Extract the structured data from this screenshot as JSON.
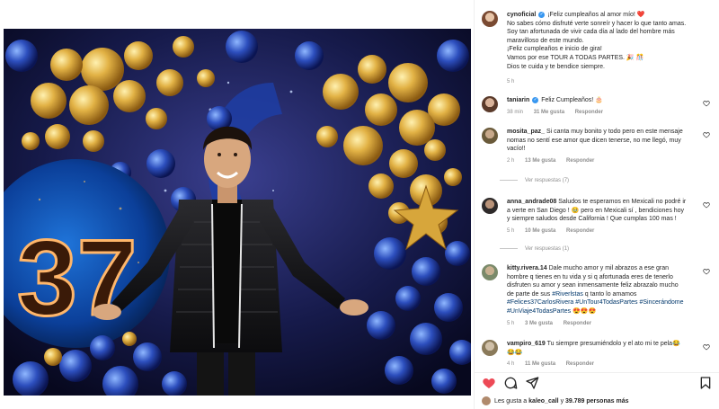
{
  "post": {
    "photo_caption_number": "37",
    "author": {
      "username": "cynoficial",
      "caption_line1": "¡Feliz cumpleaños al amor mío! ❤️",
      "caption_line2": "No sabes cómo disfruté verte sonreír y hacer lo que tanto amas.",
      "caption_line3": "Soy tan afortunada de vivir cada día al lado del hombre más",
      "caption_line4": "maravilloso de este mundo.",
      "caption_line5": "¡Feliz cumpleaños e inicio de gira!",
      "caption_line6": "Vamos por ese TOUR A TODAS PARTES. 🎉 🎊",
      "caption_line7": "Dios te cuida y te bendice siempre.",
      "time": "5 h"
    }
  },
  "comments": [
    {
      "username": "taniarin",
      "verified": true,
      "text": "Feliz Cumpleaños! 🎂",
      "time": "38 min",
      "likes": "31 Me gusta",
      "reply": "Responder"
    },
    {
      "username": "mosita_paz_",
      "text_line1": "Si canta muy bonito y todo pero en este mensaje",
      "text_line2": "nomas no sentí ese amor que dicen tenerse, no me llegó, muy",
      "text_line3": "vacío!!",
      "time": "2 h",
      "likes": "13 Me gusta",
      "reply": "Responder",
      "view_replies": "Ver respuestas (7)"
    },
    {
      "username": "anna_andrade08",
      "text_line1": "Saludos te esperamos en Mexicali no podré ir",
      "text_line2": "a verte en San Diego ! 🥹 pero en Mexicali sí , bendiciones hoy",
      "text_line3": "y siempre saludos desde California ! Que cumplas 100 mas !",
      "time": "5 h",
      "likes": "10 Me gusta",
      "reply": "Responder",
      "view_replies": "Ver respuestas (1)"
    },
    {
      "username": "kitty.rivera.14",
      "text_line1": "Dale mucho amor y mil abrazos a ese gran",
      "text_line2": "hombre q tienes en tu vida y si q afortunada eres de tenerlo",
      "text_line3": "disfruten su amor y sean inmensamente feliz abrazalo mucho",
      "text_line4": "de parte de sus",
      "text_line4_tag": "#Riverlstas",
      "text_line4_end": "q tanto lo amamos",
      "hashtags_line5": "#Felices37CarlosRivera #UnTour4TodasPartes #Sincerándome",
      "hashtags_line6": "#UnViaje4TodasPartes",
      "emojis_line6": "😍😍😍",
      "time": "5 h",
      "likes": "3 Me gusta",
      "reply": "Responder"
    },
    {
      "username": "vampiro_619",
      "text_line1": "Tu siempre presumiéndolo y el ato mi te pela😂",
      "text_line2": "😂😂",
      "time": "4 h",
      "likes": "11 Me gusta",
      "reply": "Responder"
    }
  ],
  "action_bar": {
    "likes_prefix": "Les gusta a",
    "likes_user": "kaleo_call",
    "likes_middle": "y",
    "likes_count": "39.789 personas",
    "likes_suffix": "más"
  },
  "colors": {
    "heart_red": "#ed4956",
    "link_blue": "#00376b",
    "meta_gray": "#8e8e8e",
    "verified_blue": "#3897f0"
  },
  "icons": [
    "heart-icon",
    "comment-icon",
    "share-icon",
    "save-icon",
    "verified-icon"
  ]
}
